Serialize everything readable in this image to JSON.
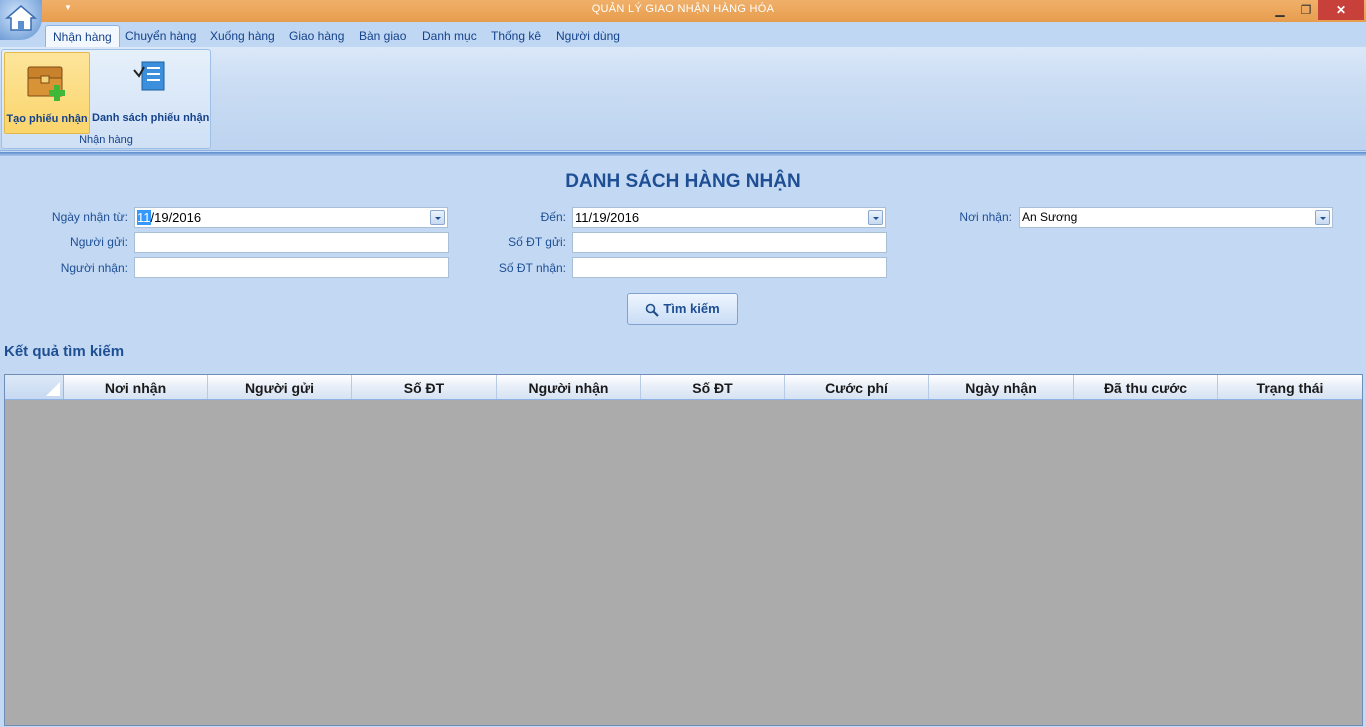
{
  "window": {
    "title": "QUẢN LÝ GIAO NHẬN HÀNG HÓA",
    "min": "▁",
    "max": "❐",
    "close": "✕"
  },
  "ribbon": {
    "tabs": [
      "Nhận hàng",
      "Chuyển hàng",
      "Xuống hàng",
      "Giao hàng",
      "Bàn giao",
      "Danh mục",
      "Thống kê",
      "Người dùng"
    ],
    "active_tab": "Nhận hàng",
    "group_label": "Nhận hàng",
    "buttons": [
      {
        "label": "Tạo phiếu nhận",
        "icon": "chest-add-icon",
        "selected": true
      },
      {
        "label": "Danh sách phiếu nhận",
        "icon": "checklist-icon",
        "selected": false
      }
    ]
  },
  "form": {
    "heading": "DANH SÁCH HÀNG NHẬN",
    "date_from_label": "Ngày nhận từ:",
    "date_from_sel": "11",
    "date_from_rest": "/19/2016",
    "date_to_label": "Đến:",
    "date_to_value": "11/19/2016",
    "place_label": "Nơi nhận:",
    "place_value": "An Sương",
    "sender_label": "Người gửi:",
    "sender_value": "",
    "sender_phone_label": "Số ĐT gửi:",
    "sender_phone_value": "",
    "receiver_label": "Người nhận:",
    "receiver_value": "",
    "receiver_phone_label": "Số ĐT nhận:",
    "receiver_phone_value": "",
    "search_button": "Tìm kiếm"
  },
  "results": {
    "title": "Kết quả tìm kiếm",
    "columns": [
      "Nơi nhận",
      "Người gửi",
      "Số ĐT",
      "Người nhận",
      "Số ĐT",
      "Cước phí",
      "Ngày nhận",
      "Đã thu cước",
      "Trạng thái"
    ],
    "rows": []
  },
  "colors": {
    "title_bar": "#e79d4d",
    "background": "#c3d9f3",
    "heading": "#1e4e94",
    "grid_empty": "#ababab"
  }
}
